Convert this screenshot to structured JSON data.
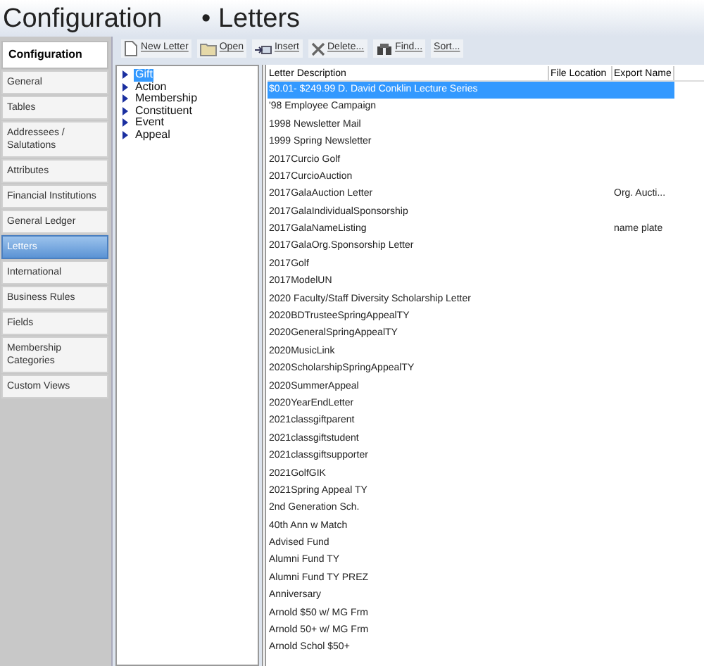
{
  "header": {
    "title": "Configuration",
    "section": "• Letters"
  },
  "sidebar": {
    "title": "Configuration",
    "items": [
      {
        "label": "General",
        "selected": false
      },
      {
        "label": "Tables",
        "selected": false
      },
      {
        "label": "Addressees / Salutations",
        "selected": false
      },
      {
        "label": "Attributes",
        "selected": false
      },
      {
        "label": "Financial Institutions",
        "selected": false
      },
      {
        "label": "General Ledger",
        "selected": false
      },
      {
        "label": "Letters",
        "selected": true
      },
      {
        "label": "International",
        "selected": false
      },
      {
        "label": "Business Rules",
        "selected": false
      },
      {
        "label": "Fields",
        "selected": false
      },
      {
        "label": "Membership Categories",
        "selected": false
      },
      {
        "label": "Custom Views",
        "selected": false
      }
    ]
  },
  "toolbar": [
    {
      "label": "New Letter",
      "kind": "new"
    },
    {
      "label": "Open",
      "kind": "open"
    },
    {
      "label": "Insert",
      "kind": "insert"
    },
    {
      "label": "Delete...",
      "kind": "delete"
    },
    {
      "label": "Find...",
      "kind": "find"
    },
    {
      "label": "Sort...",
      "kind": "sort"
    }
  ],
  "tree": [
    {
      "label": "Gift",
      "selected": true
    },
    {
      "label": "Action",
      "selected": false
    },
    {
      "label": "Membership",
      "selected": false
    },
    {
      "label": "Constituent",
      "selected": false
    },
    {
      "label": "Event",
      "selected": false
    },
    {
      "label": "Appeal",
      "selected": false
    }
  ],
  "table": {
    "columns": [
      "Letter Description",
      "File Location",
      "Export Name"
    ],
    "rows": [
      {
        "description": "$0.01- $249.99 D. David Conklin Lecture Series",
        "selected": true
      },
      {
        "description": "'98 Employee Campaign",
        "selected": false
      },
      {
        "description": "1998 Newsletter Mail",
        "selected": false
      },
      {
        "description": "1999 Spring Newsletter",
        "selected": false
      },
      {
        "description": "2017Curcio Golf",
        "selected": false
      },
      {
        "description": "2017CurcioAuction",
        "selected": false
      },
      {
        "description": "2017GalaAuction Letter",
        "export_name": "Org. Aucti...",
        "selected": false
      },
      {
        "description": "2017GalaIndividualSponsorship",
        "selected": false
      },
      {
        "description": "2017GalaNameListing",
        "export_name": "name plate",
        "selected": false
      },
      {
        "description": "2017GalaOrg.Sponsorship Letter",
        "selected": false
      },
      {
        "description": "2017Golf",
        "selected": false
      },
      {
        "description": "2017ModelUN",
        "selected": false
      },
      {
        "description": "2020 Faculty/Staff Diversity Scholarship Letter",
        "selected": false
      },
      {
        "description": "2020BDTrusteeSpringAppealTY",
        "selected": false
      },
      {
        "description": "2020GeneralSpringAppealTY",
        "selected": false
      },
      {
        "description": "2020MusicLink",
        "selected": false
      },
      {
        "description": "2020ScholarshipSpringAppealTY",
        "selected": false
      },
      {
        "description": "2020SummerAppeal",
        "selected": false
      },
      {
        "description": "2020YearEndLetter",
        "selected": false
      },
      {
        "description": "2021classgiftparent",
        "selected": false
      },
      {
        "description": "2021classgiftstudent",
        "selected": false
      },
      {
        "description": "2021classgiftsupporter",
        "selected": false
      },
      {
        "description": "2021GolfGIK",
        "selected": false
      },
      {
        "description": "2021Spring Appeal TY",
        "selected": false
      },
      {
        "description": "2nd Generation Sch.",
        "selected": false
      },
      {
        "description": "40th Ann w Match",
        "selected": false
      },
      {
        "description": "Advised Fund",
        "selected": false
      },
      {
        "description": "Alumni Fund TY",
        "selected": false
      },
      {
        "description": "Alumni Fund TY PREZ",
        "selected": false
      },
      {
        "description": "Anniversary",
        "selected": false
      },
      {
        "description": "Arnold $50 w/ MG Frm",
        "selected": false
      },
      {
        "description": "Arnold 50+ w/ MG Frm",
        "selected": false
      },
      {
        "description": "Arnold Schol $50+",
        "selected": false
      }
    ]
  }
}
